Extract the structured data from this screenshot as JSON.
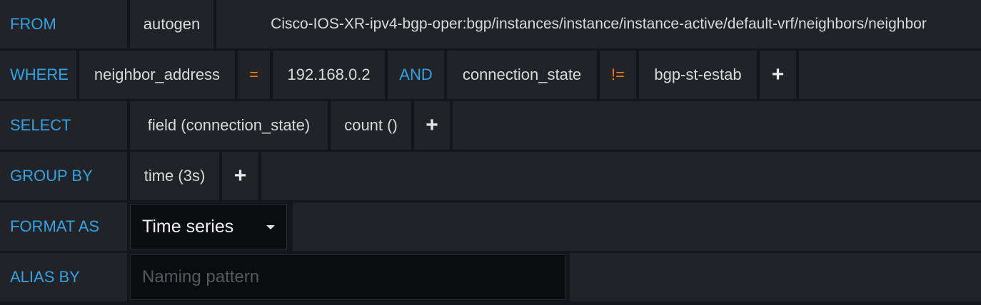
{
  "from": {
    "keyword": "FROM",
    "policy": "autogen",
    "measurement": "Cisco-IOS-XR-ipv4-bgp-oper:bgp/instances/instance/instance-active/default-vrf/neighbors/neighbor"
  },
  "where": {
    "keyword": "WHERE",
    "conditions": [
      {
        "key": "neighbor_address",
        "operator": "=",
        "value": "192.168.0.2"
      },
      {
        "connector": "AND",
        "key": "connection_state",
        "operator": "!=",
        "value": "bgp-st-estab"
      }
    ],
    "add_label": "+"
  },
  "select": {
    "keyword": "SELECT",
    "parts": [
      "field (connection_state)",
      "count ()"
    ],
    "add_label": "+"
  },
  "group_by": {
    "keyword": "GROUP BY",
    "parts": [
      "time (3s)"
    ],
    "add_label": "+"
  },
  "format_as": {
    "keyword": "FORMAT AS",
    "selected": "Time series"
  },
  "alias_by": {
    "keyword": "ALIAS BY",
    "value": "",
    "placeholder": "Naming pattern"
  },
  "colors": {
    "keyword": "#33a2e5",
    "operator": "#eb7b18",
    "segment_bg": "#212327",
    "page_bg": "#141619",
    "input_bg": "#0b0c0e"
  }
}
